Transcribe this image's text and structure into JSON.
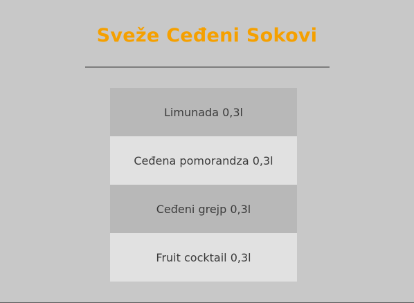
{
  "header": {
    "title": "Sveže Ceđeni Sokovi"
  },
  "menu": {
    "items": [
      {
        "label": "Limunada 0,3l"
      },
      {
        "label": "Ceđena pomorandza 0,3l"
      },
      {
        "label": "Ceđeni grejp 0,3l"
      },
      {
        "label": "Fruit cocktail 0,3l"
      }
    ]
  },
  "colors": {
    "background": "#c8c8c8",
    "title": "#f5a000",
    "row_dark": "#b8b8b8",
    "row_light": "#e1e1e1",
    "divider": "#7d7d7d",
    "text": "#3a3a3a"
  }
}
